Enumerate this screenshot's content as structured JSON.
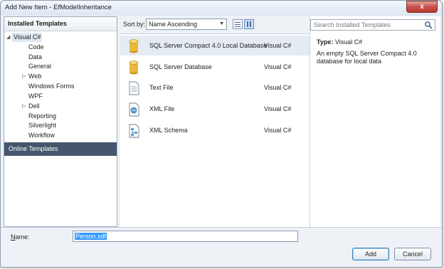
{
  "window": {
    "title": "Add New Item - EfModelInheritance",
    "close_label": "x"
  },
  "left_panel": {
    "header": "Installed Templates",
    "tree": [
      {
        "label": "Visual C#",
        "arrow": "◢"
      },
      {
        "label": "Code"
      },
      {
        "label": "Data"
      },
      {
        "label": "General"
      },
      {
        "label": "Web",
        "arrow": "▷"
      },
      {
        "label": "Windows Forms"
      },
      {
        "label": "WPF"
      },
      {
        "label": "Dell",
        "arrow": "▷"
      },
      {
        "label": "Reporting"
      },
      {
        "label": "Silverlight"
      },
      {
        "label": "Workflow"
      }
    ],
    "online": "Online Templates"
  },
  "toolbar": {
    "sort_label": "Sort by:",
    "sort_value": "Name Ascending"
  },
  "templates": [
    {
      "name": "SQL Server Compact 4.0 Local Database",
      "lang": "Visual C#",
      "icon": "database-icon",
      "selected": true
    },
    {
      "name": "SQL Server Database",
      "lang": "Visual C#",
      "icon": "database-icon"
    },
    {
      "name": "Text File",
      "lang": "Visual C#",
      "icon": "text-file-icon"
    },
    {
      "name": "XML File",
      "lang": "Visual C#",
      "icon": "xml-file-icon"
    },
    {
      "name": "XML Schema",
      "lang": "Visual C#",
      "icon": "xml-schema-icon"
    }
  ],
  "details": {
    "search_placeholder": "Search Installed Templates",
    "type_label": "Type:",
    "type_value": "Visual C#",
    "description": "An empty SQL Server Compact 4.0 database for local data"
  },
  "footer": {
    "name_label": "Name:",
    "name_value": "Person.sdf",
    "add_label": "Add",
    "cancel_label": "Cancel"
  },
  "colors": {
    "selected_row": "#e5ebf3",
    "online_bg": "#46576d",
    "db_gold": "#e8b93a"
  }
}
